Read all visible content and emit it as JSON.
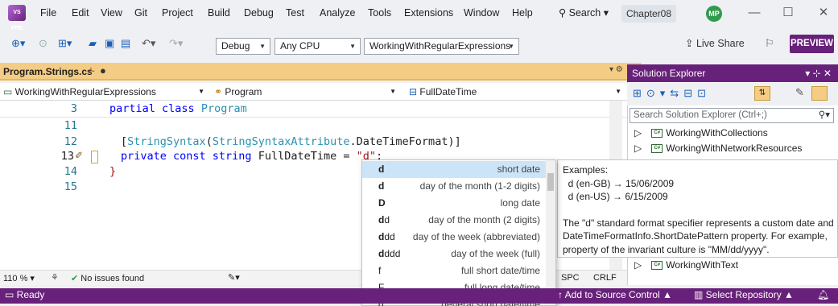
{
  "menubar": {
    "logo": "VS PRE",
    "items": [
      "File",
      "Edit",
      "View",
      "Git",
      "Project",
      "Build",
      "Debug",
      "Test",
      "Analyze",
      "Tools",
      "Extensions",
      "Window",
      "Help"
    ],
    "search_label": "Search",
    "solution_name": "Chapter08",
    "avatar_initials": "MP"
  },
  "toolbar": {
    "config": "Debug",
    "platform": "Any CPU",
    "startup_project": "WorkingWithRegularExpressions",
    "live_share": "Live Share",
    "preview": "PREVIEW"
  },
  "editor_tab": {
    "label": "Program.Strings.cs",
    "pin": "⊹",
    "dirty": "●"
  },
  "navbar": {
    "project": "WorkingWithRegularExpressions",
    "class": "Program",
    "member": "FullDateTime"
  },
  "code": {
    "line_numbers": [
      "3",
      "11",
      "12",
      "13",
      "14",
      "15"
    ],
    "line3": {
      "kw": "partial class",
      "type": "Program"
    },
    "line12": {
      "open": "[",
      "attr": "StringSyntax",
      "paren": "(",
      "cls": "StringSyntaxAttribute",
      ".": ".",
      "member": "DateTimeFormat",
      "close": ")]"
    },
    "line13": {
      "kw": "private const string",
      "name": "FullDateTime",
      "eq": " = ",
      "str": "\"d\"",
      "semi": ";"
    },
    "line14": "}"
  },
  "completion": {
    "items": [
      {
        "bold": "d",
        "light": "",
        "desc": "short date"
      },
      {
        "bold": "d",
        "light": "",
        "desc": "day of the month (1-2 digits)"
      },
      {
        "bold": "D",
        "light": "",
        "desc": "long date"
      },
      {
        "bold": "d",
        "light": "d",
        "desc": "day of the month (2 digits)"
      },
      {
        "bold": "d",
        "light": "dd",
        "desc": "day of the week (abbreviated)"
      },
      {
        "bold": "d",
        "light": "ddd",
        "desc": "day of the week (full)"
      },
      {
        "bold": "",
        "light": "f",
        "desc": "full short date/time"
      },
      {
        "bold": "",
        "light": "F",
        "desc": "full long date/time"
      },
      {
        "bold": "",
        "light": "g",
        "desc": "general short date/time"
      }
    ]
  },
  "tooltip": {
    "lines": [
      "Examples:",
      "  d (en-GB) → 15/06/2009",
      "  d (en-US) → 6/15/2009",
      "",
      "The \"d\" standard format specifier represents a custom date and",
      "DateTimeFormatInfo.ShortDatePattern property. For example,",
      "property of the invariant culture is \"MM/dd/yyyy\"."
    ]
  },
  "editor_status": {
    "zoom": "110 %",
    "issues": "No issues found",
    "spc": "SPC",
    "crlf": "CRLF"
  },
  "solution_explorer": {
    "title": "Solution Explorer",
    "search_placeholder": "Search Solution Explorer (Ctrl+;)",
    "items": [
      "WorkingWithCollections",
      "WorkingWithNetworkResources",
      "WorkingWithText"
    ]
  },
  "statusbar": {
    "ready": "Ready",
    "source_control": "Add to Source Control",
    "select_repo": "Select Repository"
  }
}
